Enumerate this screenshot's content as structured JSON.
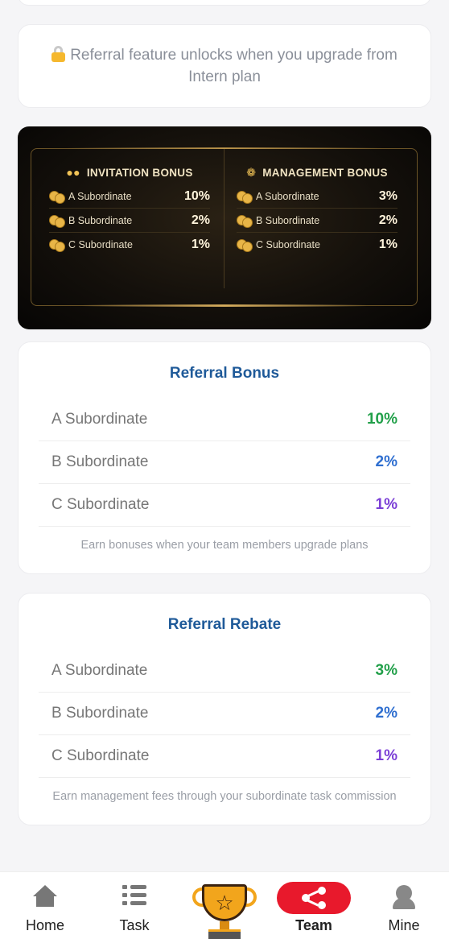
{
  "notice": {
    "text": "Referral feature unlocks when you upgrade from Intern plan"
  },
  "banner": {
    "invitation": {
      "title": "INVITATION BONUS",
      "rows": [
        {
          "label": "A Subordinate",
          "value": "10%"
        },
        {
          "label": "B Subordinate",
          "value": "2%"
        },
        {
          "label": "C Subordinate",
          "value": "1%"
        }
      ]
    },
    "management": {
      "title": "MANAGEMENT BONUS",
      "rows": [
        {
          "label": "A Subordinate",
          "value": "3%"
        },
        {
          "label": "B Subordinate",
          "value": "2%"
        },
        {
          "label": "C Subordinate",
          "value": "1%"
        }
      ]
    }
  },
  "referral_bonus": {
    "title": "Referral Bonus",
    "rows": [
      {
        "label": "A Subordinate",
        "value": "10%"
      },
      {
        "label": "B Subordinate",
        "value": "2%"
      },
      {
        "label": "C Subordinate",
        "value": "1%"
      }
    ],
    "note": "Earn bonuses when your team members upgrade plans"
  },
  "referral_rebate": {
    "title": "Referral Rebate",
    "rows": [
      {
        "label": "A Subordinate",
        "value": "3%"
      },
      {
        "label": "B Subordinate",
        "value": "2%"
      },
      {
        "label": "C Subordinate",
        "value": "1%"
      }
    ],
    "note": "Earn management fees through your subordinate task commission"
  },
  "nav": {
    "home": "Home",
    "task": "Task",
    "team": "Team",
    "mine": "Mine"
  },
  "colors": {
    "accent": "#e8192c",
    "title_blue": "#1f5a99",
    "value_a": "#22a04a",
    "value_b": "#2f6fd0",
    "value_c": "#7b3fd6"
  }
}
